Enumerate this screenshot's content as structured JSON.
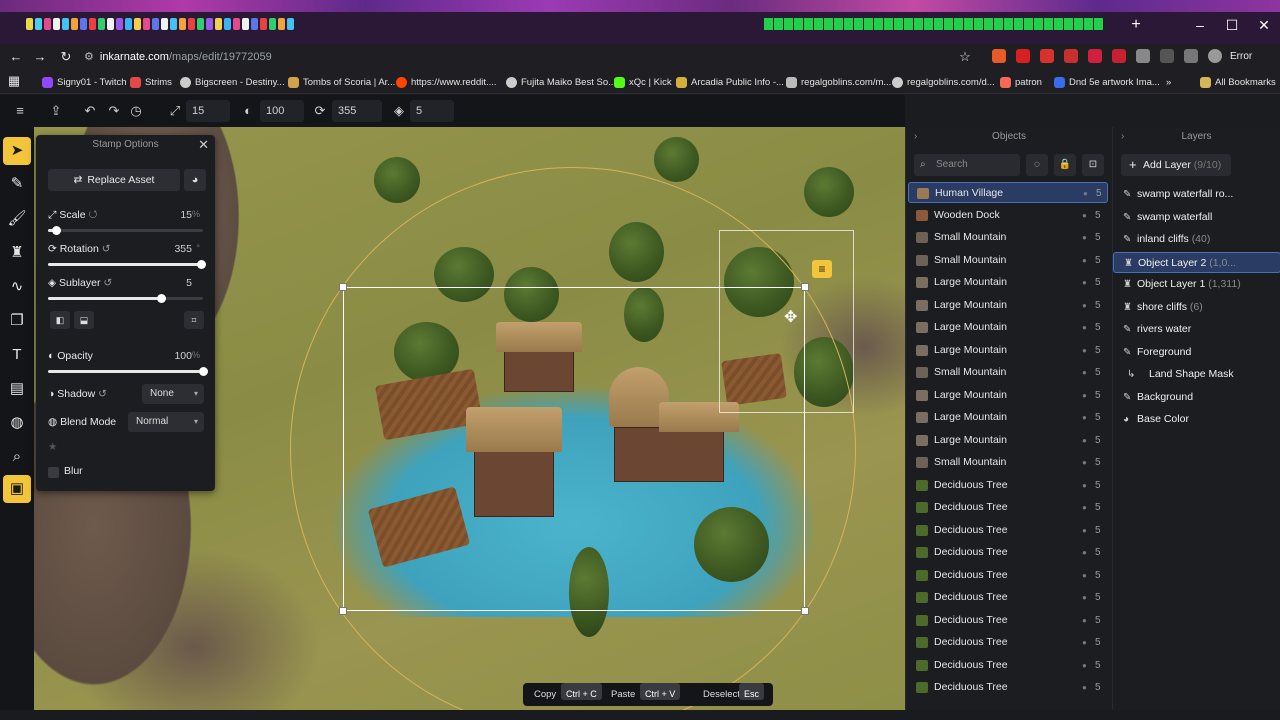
{
  "browser": {
    "url_host": "inkarnate.com",
    "url_path": "/maps/edit/19772059",
    "profile_status": "Error",
    "bookmarks": [
      "Signy01 - Twitch",
      "Strims",
      "Bigscreen - Destiny...",
      "Tombs of Scoria | Ar...",
      "https://www.reddit....",
      "Fujita Maiko Best So...",
      "xQc | Kick",
      "Arcadia Public Info -...",
      "regalgoblins.com/m...",
      "regalgoblins.com/d...",
      "patron",
      "Dnd 5e artwork Ima...",
      "All Bookmarks"
    ]
  },
  "toolbar": {
    "scale_value": "15",
    "opacity_value": "100",
    "rotation_value": "355",
    "sublayer_value": "5"
  },
  "stamp_options": {
    "title": "Stamp Options",
    "replace_asset": "Replace Asset",
    "scale_label": "Scale",
    "scale_value": "15",
    "scale_unit": "%",
    "scale_fraction": 0.05,
    "rotation_label": "Rotation",
    "rotation_value": "355",
    "rotation_unit": "°",
    "rotation_fraction": 0.986,
    "sublayer_label": "Sublayer",
    "sublayer_value": "5",
    "sublayer_fraction": 0.73,
    "opacity_label": "Opacity",
    "opacity_value": "100",
    "opacity_unit": "%",
    "opacity_fraction": 1.0,
    "shadow_label": "Shadow",
    "shadow_value": "None",
    "blend_label": "Blend Mode",
    "blend_value": "Normal",
    "blur_label": "Blur"
  },
  "objects": {
    "title": "Objects",
    "search_placeholder": "Search",
    "items": [
      {
        "name": "Human Village",
        "num": "5",
        "color": "#9a7a55"
      },
      {
        "name": "Wooden Dock",
        "num": "5",
        "color": "#8a5a3a"
      },
      {
        "name": "Small Mountain",
        "num": "5",
        "color": "#6e6257"
      },
      {
        "name": "Small Mountain",
        "num": "5",
        "color": "#6e6257"
      },
      {
        "name": "Large Mountain",
        "num": "5",
        "color": "#7b6d60"
      },
      {
        "name": "Large Mountain",
        "num": "5",
        "color": "#7b6d60"
      },
      {
        "name": "Large Mountain",
        "num": "5",
        "color": "#7b6d60"
      },
      {
        "name": "Large Mountain",
        "num": "5",
        "color": "#7b6d60"
      },
      {
        "name": "Small Mountain",
        "num": "5",
        "color": "#6e6257"
      },
      {
        "name": "Large Mountain",
        "num": "5",
        "color": "#7b6d60"
      },
      {
        "name": "Large Mountain",
        "num": "5",
        "color": "#7b6d60"
      },
      {
        "name": "Large Mountain",
        "num": "5",
        "color": "#7b6d60"
      },
      {
        "name": "Small Mountain",
        "num": "5",
        "color": "#6e6257"
      },
      {
        "name": "Deciduous Tree",
        "num": "5",
        "color": "#4c6b2a"
      },
      {
        "name": "Deciduous Tree",
        "num": "5",
        "color": "#4c6b2a"
      },
      {
        "name": "Deciduous Tree",
        "num": "5",
        "color": "#4c6b2a"
      },
      {
        "name": "Deciduous Tree",
        "num": "5",
        "color": "#4c6b2a"
      },
      {
        "name": "Deciduous Tree",
        "num": "5",
        "color": "#4c6b2a"
      },
      {
        "name": "Deciduous Tree",
        "num": "5",
        "color": "#4c6b2a"
      },
      {
        "name": "Deciduous Tree",
        "num": "5",
        "color": "#4c6b2a"
      },
      {
        "name": "Deciduous Tree",
        "num": "5",
        "color": "#4c6b2a"
      },
      {
        "name": "Deciduous Tree",
        "num": "5",
        "color": "#4c6b2a"
      },
      {
        "name": "Deciduous Tree",
        "num": "5",
        "color": "#4c6b2a"
      }
    ]
  },
  "layers": {
    "title": "Layers",
    "add_layer": "Add Layer",
    "add_layer_count": "(9/10)",
    "items": [
      {
        "name": "swamp waterfall ro...",
        "count": "",
        "icon": "brush"
      },
      {
        "name": "swamp waterfall",
        "count": "",
        "icon": "brush"
      },
      {
        "name": "inland cliffs",
        "count": "(40)",
        "icon": "brush"
      },
      {
        "name": "Object Layer 2",
        "count": "(1,0...",
        "icon": "object"
      },
      {
        "name": "Object Layer 1",
        "count": "(1,311)",
        "icon": "object"
      },
      {
        "name": "shore cliffs",
        "count": "(6)",
        "icon": "object"
      },
      {
        "name": "rivers water",
        "count": "",
        "icon": "brush"
      },
      {
        "name": "Foreground",
        "count": "",
        "icon": "brush"
      },
      {
        "name": "Land Shape Mask",
        "count": "",
        "icon": "sub"
      },
      {
        "name": "Background",
        "count": "",
        "icon": "brush"
      },
      {
        "name": "Base Color",
        "count": "",
        "icon": "palette"
      }
    ]
  },
  "hints": {
    "copy": "Copy",
    "copy_key": "Ctrl + C",
    "paste": "Paste",
    "paste_key": "Ctrl + V",
    "deselect": "Deselect",
    "deselect_key": "Esc"
  },
  "colors": {
    "accent": "#f3c53a",
    "selection": "#2a3c63"
  }
}
